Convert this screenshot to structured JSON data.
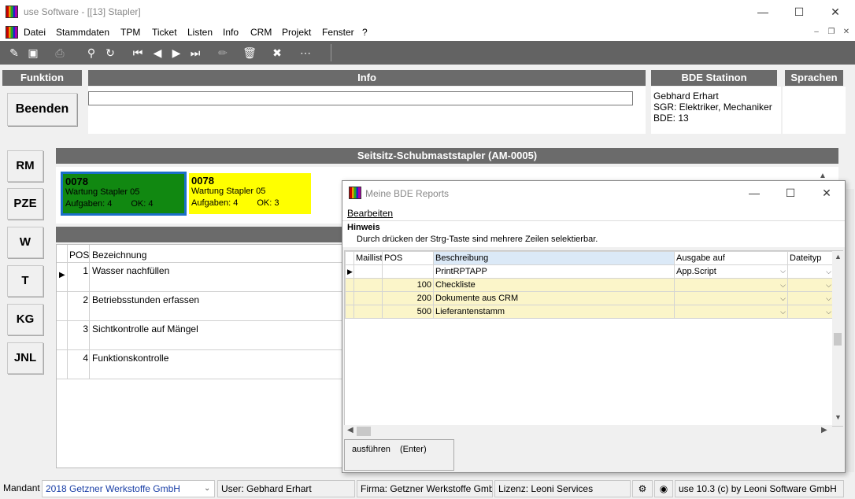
{
  "window": {
    "title": "use Software - [[13] Stapler]"
  },
  "menu": [
    "Datei",
    "Stammdaten",
    "TPM",
    "Ticket",
    "Listen",
    "Info",
    "CRM",
    "Projekt",
    "Fenster",
    "?"
  ],
  "sections": {
    "funktion": "Funktion",
    "info": "Info",
    "bde_station": "BDE Statinon",
    "sprachen": "Sprachen"
  },
  "funktion_button": "Beenden",
  "bde": {
    "line1": "Gebhard Erhart",
    "line2": "SGR: Elektriker, Mechaniker",
    "line3": "BDE: 13"
  },
  "side_buttons": [
    "RM",
    "PZE",
    "W",
    "T",
    "KG",
    "JNL"
  ],
  "machine_title": "Seitsitz-Schubmaststapler (AM-0005)",
  "cards": [
    {
      "num": "0078",
      "desc": "Wartung Stapler 05",
      "tasks": "Aufgaben: 4",
      "ok": "OK: 4",
      "color": "#118811"
    },
    {
      "num": "0078",
      "desc": "Wartung Stapler 05",
      "tasks": "Aufgaben: 4",
      "ok": "OK: 3",
      "color": "#ffff00"
    }
  ],
  "tasks_table": {
    "headers": {
      "pos": "POS",
      "bezeichnung": "Bezeichnung"
    },
    "rows": [
      {
        "pos": "1",
        "text": "Wasser nachfüllen"
      },
      {
        "pos": "2",
        "text": "Betriebsstunden erfassen"
      },
      {
        "pos": "3",
        "text": "Sichtkontrolle auf Mängel"
      },
      {
        "pos": "4",
        "text": "Funktionskontrolle"
      }
    ]
  },
  "dialog": {
    "title": "Meine BDE Reports",
    "menu_edit": "Bearbeiten",
    "hint_title": "Hinweis",
    "hint_text": "Durch drücken der Strg-Taste sind mehrere Zeilen selektierbar.",
    "headers": {
      "maillist": "Maillist",
      "pos": "POS",
      "beschreibung": "Beschreibung",
      "ausgabe": "Ausgabe auf",
      "dateityp": "Dateityp"
    },
    "rows": [
      {
        "pos": "",
        "beschreibung": "PrintRPTAPP",
        "ausgabe": "App.Script"
      },
      {
        "pos": "100",
        "beschreibung": "Checkliste",
        "ausgabe": ""
      },
      {
        "pos": "200",
        "beschreibung": "Dokumente aus CRM",
        "ausgabe": ""
      },
      {
        "pos": "500",
        "beschreibung": "Lieferantenstamm",
        "ausgabe": ""
      }
    ],
    "execute_label": "ausführen",
    "execute_key": "(Enter)"
  },
  "status": {
    "mandant_label": "Mandant",
    "mandant_value": "2018 Getzner Werkstoffe GmbH",
    "user": "User: Gebhard Erhart",
    "firma": "Firma: Getzner Werkstoffe GmbH",
    "lizenz": "Lizenz: Leoni Services",
    "version": "use 10.3 (c) by Leoni Software GmbH"
  }
}
